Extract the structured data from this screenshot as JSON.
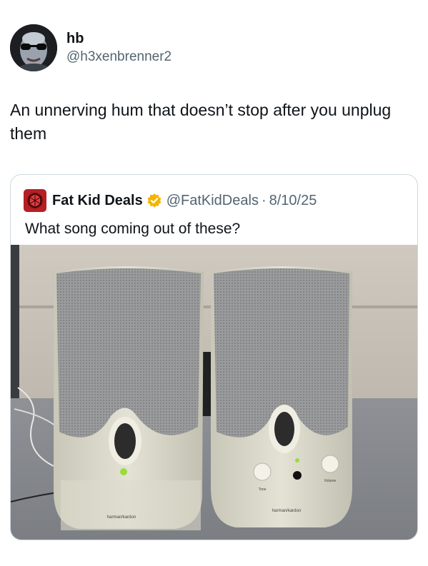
{
  "tweet": {
    "author_name": "hb",
    "author_handle": "@h3xenbrenner2",
    "text": "An unnerving hum that doesn’t stop after you unplug them"
  },
  "quoted_tweet": {
    "author_name": "Fat Kid Deals",
    "author_handle": "@FatKidDeals",
    "separator": "·",
    "date": "8/10/25",
    "text": "What song coming out of these?",
    "media": {
      "description_icon": "photo",
      "brand_text": "harman/kardon",
      "knob_labels": [
        "Tone",
        "Volume"
      ]
    }
  },
  "colors": {
    "text": "#0f1419",
    "secondary": "#536471",
    "border": "#cfd9de",
    "verified": "#f4b400"
  }
}
